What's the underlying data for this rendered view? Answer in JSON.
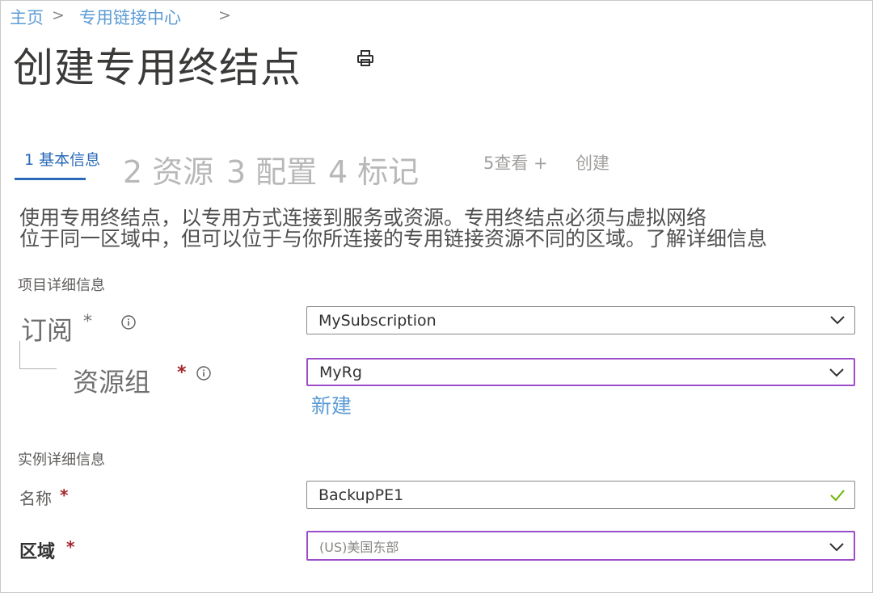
{
  "breadcrumb": {
    "home": "主页",
    "sep1": ">",
    "center": "专用链接中心",
    "sep2": ">"
  },
  "page": {
    "title": "创建专用终结点"
  },
  "tabs": {
    "basics": "1 基本信息",
    "resource": "2 资源",
    "config": "3 配置",
    "tags": "4 标记",
    "review": "5查看 +",
    "create": "创建"
  },
  "description": {
    "line1": "使用专用终结点，以专用方式连接到服务或资源。专用终结点必须与虚拟网络",
    "line2": "位于同一区域中，但可以位于与你所连接的专用链接资源不同的区域。了解详细信息"
  },
  "project_details": {
    "heading": "项目详细信息",
    "subscription_label": "订阅",
    "subscription_value": "MySubscription",
    "resource_group_label": "资源组",
    "resource_group_value": "MyRg",
    "create_new": "新建"
  },
  "instance_details": {
    "heading": "实例详细信息",
    "name_label": "名称",
    "name_value": "BackupPE1",
    "region_label": "区域",
    "region_value": "(US)美国东部"
  },
  "required_mark": "*",
  "icons": {
    "print": "printer-icon",
    "info": "info-icon",
    "dropdown": "chevron-down-icon",
    "valid": "checkmark-icon"
  },
  "colors": {
    "link": "#5b9bd5",
    "tab_active": "#2a6ab8",
    "required": "#a4262c",
    "focus_border": "#9b4dca",
    "valid": "#6bb700"
  }
}
